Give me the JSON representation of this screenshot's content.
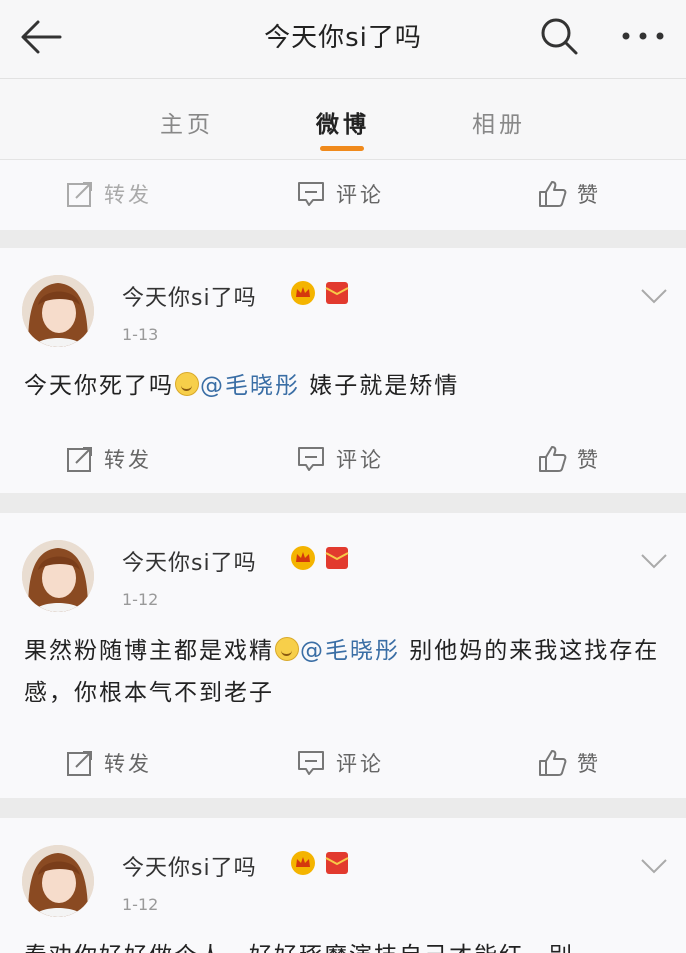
{
  "header": {
    "title": "今天你si了吗",
    "back_icon": "arrow-left-icon",
    "search_icon": "search-icon",
    "more_icon": "more-dots-icon"
  },
  "tabs": [
    {
      "label": "主页",
      "active": false
    },
    {
      "label": "微博",
      "active": true
    },
    {
      "label": "相册",
      "active": false
    }
  ],
  "accent_color": "#f08a1c",
  "actions": {
    "repost": "转发",
    "comment": "评论",
    "like": "赞"
  },
  "posts": [
    {
      "username": "今天你si了吗",
      "time": "1-13",
      "text_before": "今天你死了吗",
      "mention": "@毛晓彤",
      "text_after": "  婊子就是矫情"
    },
    {
      "username": "今天你si了吗",
      "time": "1-12",
      "text_before": "果然粉随博主都是戏精",
      "mention": "@毛晓彤",
      "text_after": " 别他妈的来我这找存在感，你根本气不到老子"
    },
    {
      "username": "今天你si了吗",
      "time": "1-12",
      "text_before": "奉劝你好好做个人，好好琢磨演技自己才能红，别",
      "mention": "",
      "text_after": ""
    }
  ]
}
